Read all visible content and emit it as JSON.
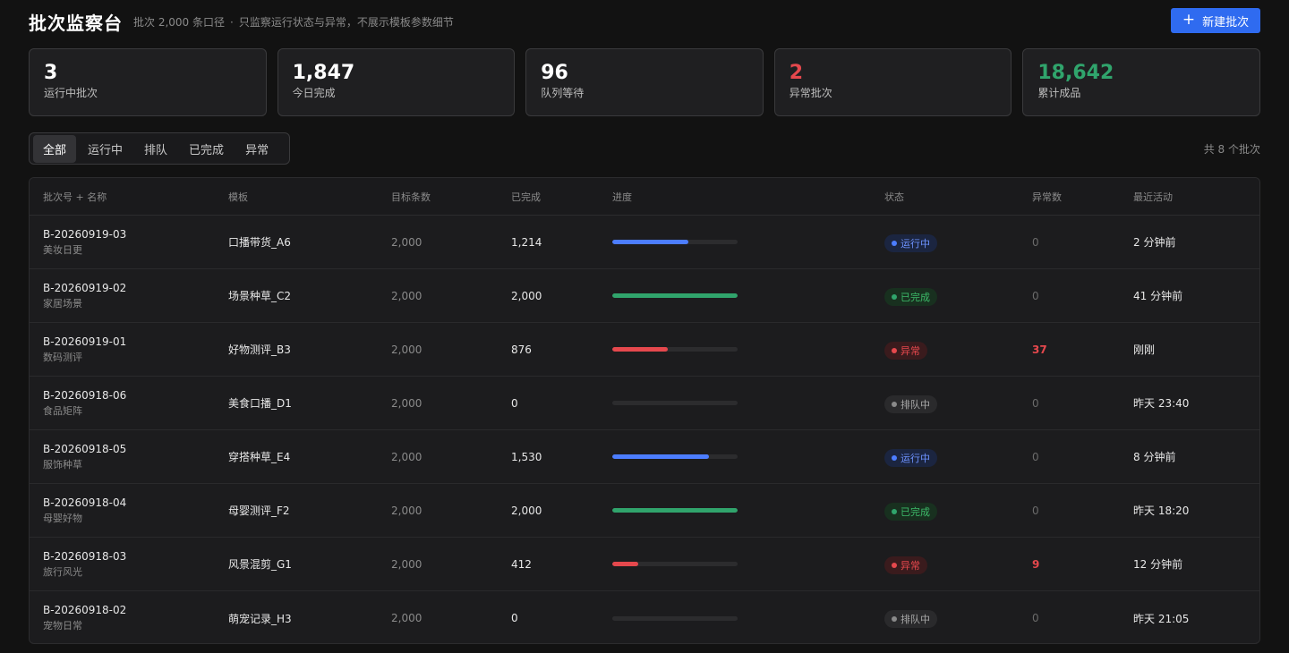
{
  "header": {
    "title": "批次监察台",
    "subtitle_part1": "批次 2,000 条口径",
    "subtitle_sep": "·",
    "subtitle_part2": "只监察运行状态与异常，不展示模板参数细节",
    "new_button_icon": "plus-icon",
    "new_button_label": "新建批次"
  },
  "stats": [
    {
      "value": "3",
      "label": "运行中批次",
      "tone": "normal"
    },
    {
      "value": "1,847",
      "label": "今日完成",
      "tone": "normal"
    },
    {
      "value": "96",
      "label": "队列等待",
      "tone": "normal"
    },
    {
      "value": "2",
      "label": "异常批次",
      "tone": "red"
    },
    {
      "value": "18,642",
      "label": "累计成品",
      "tone": "green"
    }
  ],
  "tabs": [
    "全部",
    "运行中",
    "排队",
    "已完成",
    "异常"
  ],
  "active_tab": "全部",
  "total_count": "共 8 个批次",
  "columns": [
    "批次号 + 名称",
    "模板",
    "目标条数",
    "已完成",
    "进度",
    "状态",
    "异常数",
    "最近活动"
  ],
  "status_colors": {
    "running": "#4c7dff",
    "done": "#30a46c",
    "error": "#e5484d",
    "queued": "#3a3a3c"
  },
  "rows": [
    {
      "id": "B-20260919-03",
      "name": "美妆日更",
      "template": "口播带货_A6",
      "target": "2,000",
      "done": "1,214",
      "progress": 0.607,
      "status": "运行中",
      "status_key": "running",
      "errors": "0",
      "activity": "2 分钟前"
    },
    {
      "id": "B-20260919-02",
      "name": "家居场景",
      "template": "场景种草_C2",
      "target": "2,000",
      "done": "2,000",
      "progress": 1.0,
      "status": "已完成",
      "status_key": "done",
      "errors": "0",
      "activity": "41 分钟前"
    },
    {
      "id": "B-20260919-01",
      "name": "数码测评",
      "template": "好物测评_B3",
      "target": "2,000",
      "done": "876",
      "progress": 0.438,
      "status": "异常",
      "status_key": "error",
      "errors": "37",
      "activity": "刚刚"
    },
    {
      "id": "B-20260918-06",
      "name": "食品矩阵",
      "template": "美食口播_D1",
      "target": "2,000",
      "done": "0",
      "progress": 0,
      "status": "排队中",
      "status_key": "queued",
      "errors": "0",
      "activity": "昨天 23:40"
    },
    {
      "id": "B-20260918-05",
      "name": "服饰种草",
      "template": "穿搭种草_E4",
      "target": "2,000",
      "done": "1,530",
      "progress": 0.765,
      "status": "运行中",
      "status_key": "running",
      "errors": "0",
      "activity": "8 分钟前"
    },
    {
      "id": "B-20260918-04",
      "name": "母婴好物",
      "template": "母婴测评_F2",
      "target": "2,000",
      "done": "2,000",
      "progress": 1.0,
      "status": "已完成",
      "status_key": "done",
      "errors": "0",
      "activity": "昨天 18:20"
    },
    {
      "id": "B-20260918-03",
      "name": "旅行风光",
      "template": "风景混剪_G1",
      "target": "2,000",
      "done": "412",
      "progress": 0.206,
      "status": "异常",
      "status_key": "error",
      "errors": "9",
      "activity": "12 分钟前"
    },
    {
      "id": "B-20260918-02",
      "name": "宠物日常",
      "template": "萌宠记录_H3",
      "target": "2,000",
      "done": "0",
      "progress": 0,
      "status": "排队中",
      "status_key": "queued",
      "errors": "0",
      "activity": "昨天 21:05"
    }
  ]
}
